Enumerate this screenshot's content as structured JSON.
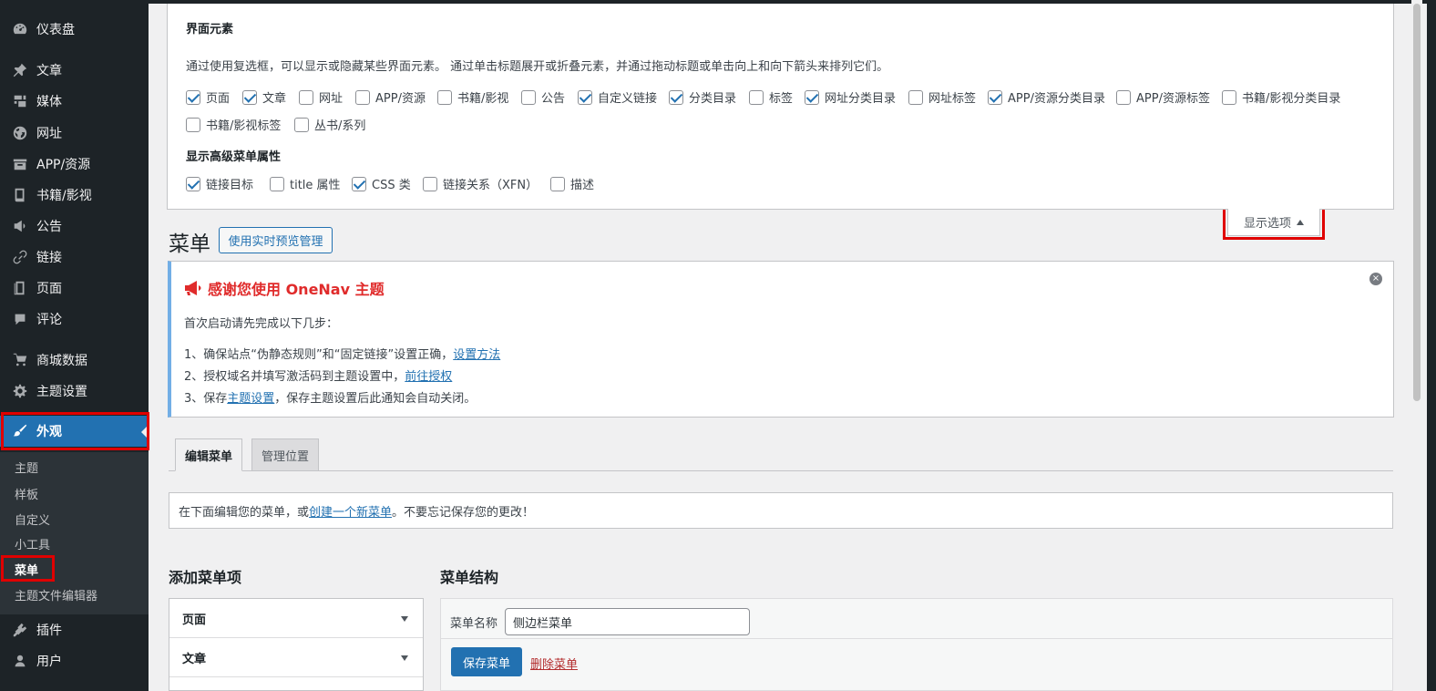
{
  "sidebar": {
    "items": [
      {
        "label": "仪表盘",
        "icon": "dashboard-icon"
      },
      {
        "label": "文章",
        "icon": "pin-icon"
      },
      {
        "label": "媒体",
        "icon": "media-icon"
      },
      {
        "label": "网址",
        "icon": "globe-icon"
      },
      {
        "label": "APP/资源",
        "icon": "archive-icon"
      },
      {
        "label": "书籍/影视",
        "icon": "book-icon"
      },
      {
        "label": "公告",
        "icon": "megaphone-icon"
      },
      {
        "label": "链接",
        "icon": "link-icon"
      },
      {
        "label": "页面",
        "icon": "page-icon"
      },
      {
        "label": "评论",
        "icon": "comment-icon"
      },
      {
        "label": "商城数据",
        "icon": "cart-icon"
      },
      {
        "label": "主题设置",
        "icon": "gear-icon"
      },
      {
        "label": "外观",
        "icon": "brush-icon"
      },
      {
        "label": "插件",
        "icon": "plugin-icon"
      },
      {
        "label": "用户",
        "icon": "user-icon"
      }
    ],
    "submenu": [
      "主题",
      "样板",
      "自定义",
      "小工具",
      "菜单",
      "主题文件编辑器"
    ],
    "active_item": "外观",
    "current_subitem": "菜单"
  },
  "screen_options": {
    "heading1": "界面元素",
    "desc": "通过使用复选框，可以显示或隐藏某些界面元素。 通过单击标题展开或折叠元素，并通过拖动标题或单击向上和向下箭头来排列它们。",
    "elements": [
      {
        "label": "页面",
        "checked": true
      },
      {
        "label": "文章",
        "checked": true
      },
      {
        "label": "网址",
        "checked": false
      },
      {
        "label": "APP/资源",
        "checked": false
      },
      {
        "label": "书籍/影视",
        "checked": false
      },
      {
        "label": "公告",
        "checked": false
      },
      {
        "label": "自定义链接",
        "checked": true
      },
      {
        "label": "分类目录",
        "checked": true
      },
      {
        "label": "标签",
        "checked": false
      },
      {
        "label": "网址分类目录",
        "checked": true
      },
      {
        "label": "网址标签",
        "checked": false
      },
      {
        "label": "APP/资源分类目录",
        "checked": true
      },
      {
        "label": "APP/资源标签",
        "checked": false
      },
      {
        "label": "书籍/影视分类目录",
        "checked": false
      },
      {
        "label": "书籍/影视标签",
        "checked": false
      },
      {
        "label": "丛书/系列",
        "checked": false
      }
    ],
    "heading2": "显示高级菜单属性",
    "advanced": [
      {
        "label": "链接目标",
        "checked": true
      },
      {
        "label": "title 属性",
        "checked": false
      },
      {
        "label": "CSS 类",
        "checked": true
      },
      {
        "label": "链接关系（XFN）",
        "checked": false
      },
      {
        "label": "描述",
        "checked": false
      }
    ],
    "toggle_label": "显示选项"
  },
  "page": {
    "title": "菜单",
    "preview_button": "使用实时预览管理"
  },
  "notice": {
    "title": "感谢您使用 OneNav 主题",
    "intro": "首次启动请先完成以下几步：",
    "step1_text": "1、确保站点“伪静态规则”和“固定链接”设置正确，",
    "step1_link": "设置方法",
    "step2_text": "2、授权域名并填写激活码到主题设置中，",
    "step2_link": "前往授权",
    "step3_prefix": "3、保存",
    "step3_link": "主题设置",
    "step3_suffix": "，保存主题设置后此通知会自动关闭。",
    "close_symbol": "×"
  },
  "tabs": [
    {
      "label": "编辑菜单",
      "active": true
    },
    {
      "label": "管理位置",
      "active": false
    }
  ],
  "manage": {
    "prefix": "在下面编辑您的菜单，或",
    "link": "创建一个新菜单",
    "suffix": "。不要忘记保存您的更改！"
  },
  "add_items": {
    "heading": "添加菜单项",
    "sections": [
      "页面",
      "文章"
    ]
  },
  "structure": {
    "heading": "菜单结构",
    "name_label": "菜单名称",
    "name_value": "侧边栏菜单",
    "save_button": "保存菜单",
    "delete_link": "删除菜单"
  },
  "colors": {
    "sidebar_bg": "#1d2327",
    "active_bg": "#2271b1",
    "highlight_border": "#e00000",
    "notice_title": "#e02b2b",
    "link": "#2271b1"
  }
}
